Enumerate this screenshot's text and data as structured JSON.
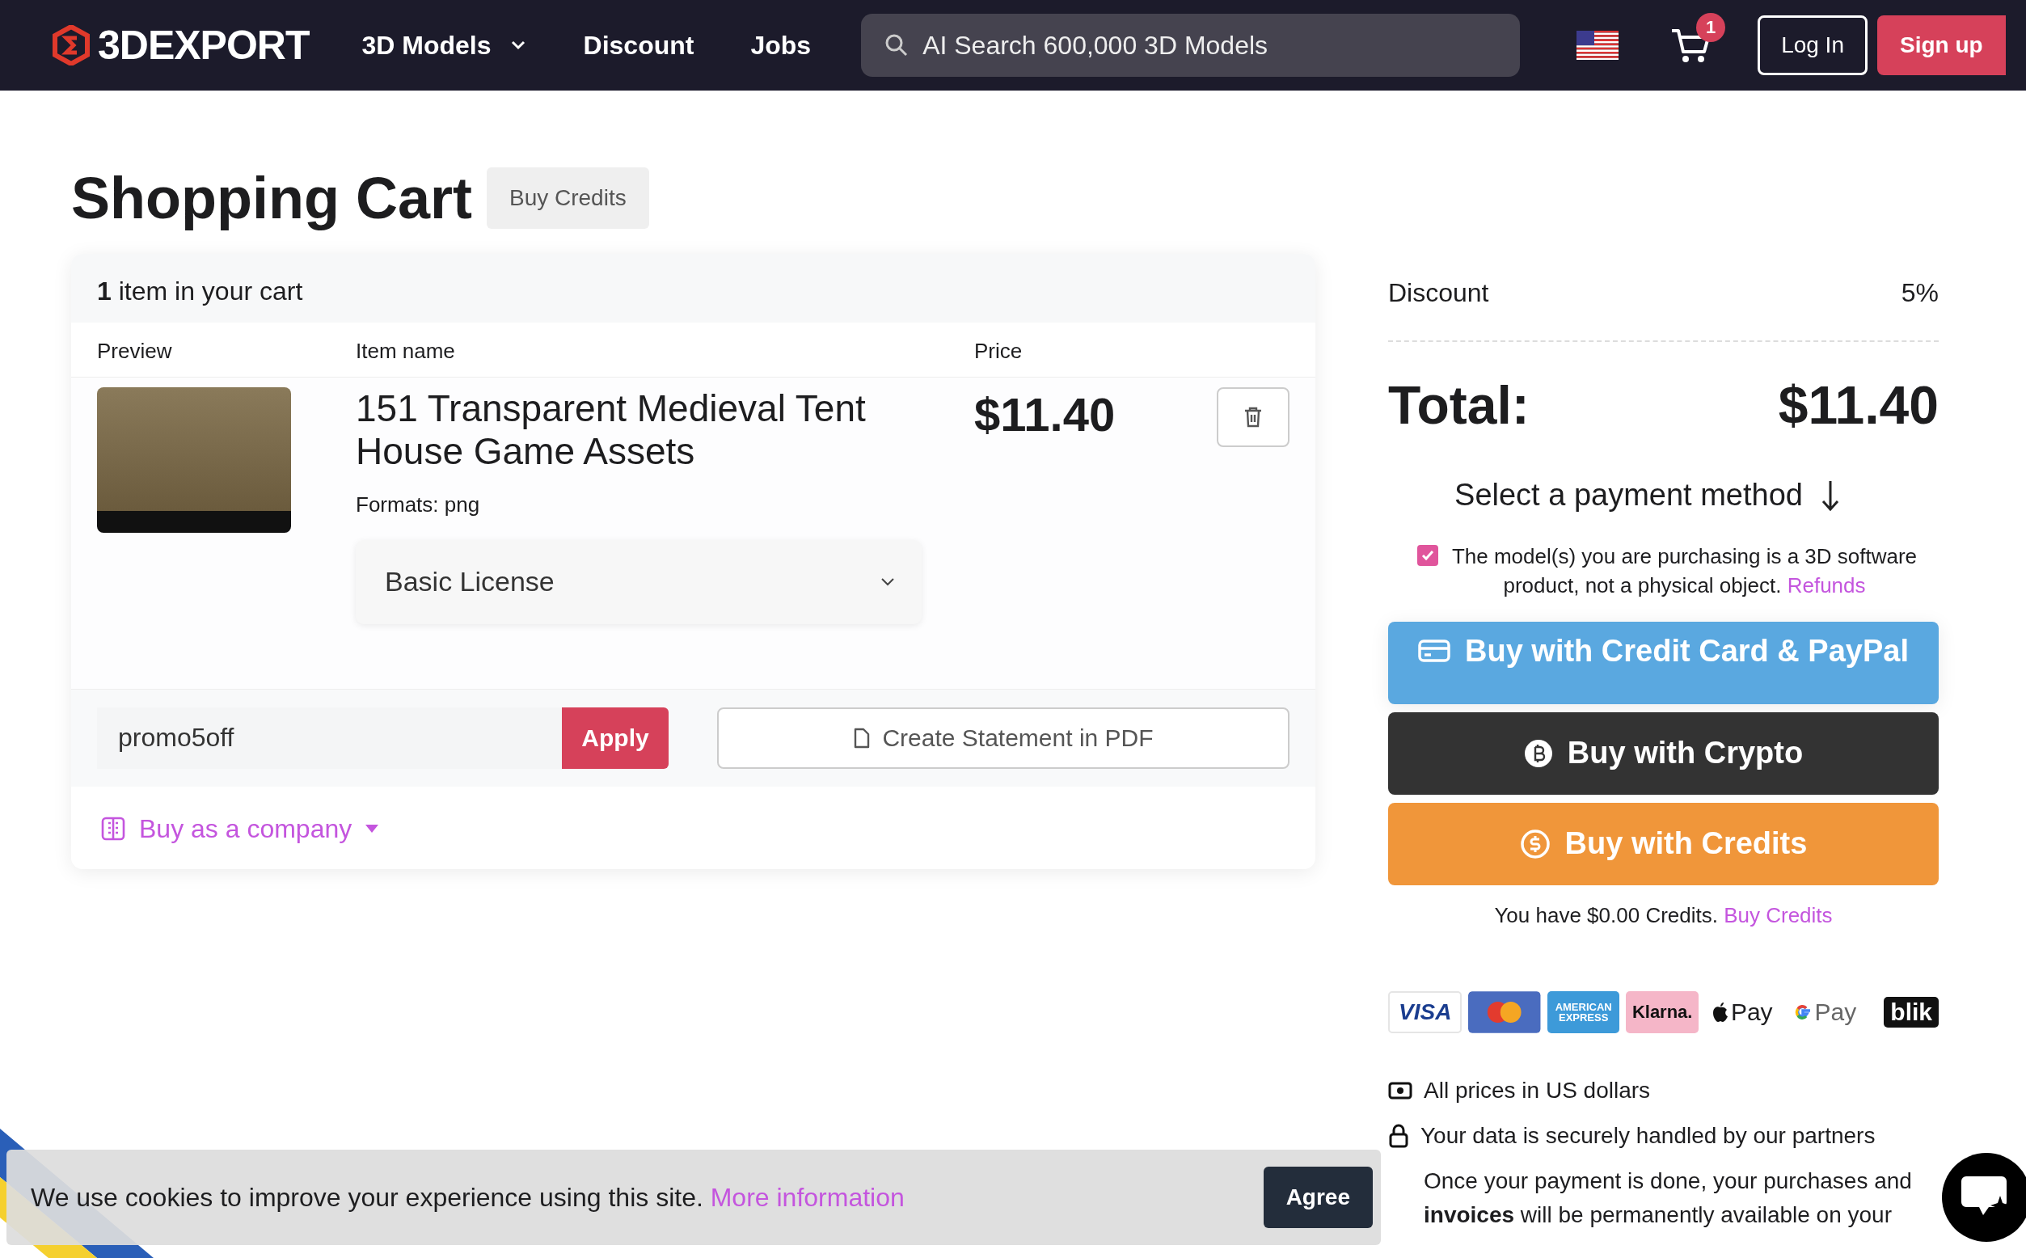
{
  "header": {
    "logo": "3DEXPORT",
    "nav": [
      {
        "label": "3D Models",
        "dropdown": true
      },
      {
        "label": "Discount",
        "dropdown": false
      },
      {
        "label": "Jobs",
        "dropdown": false
      }
    ],
    "search": {
      "placeholder": "AI Search 600,000 3D Models"
    },
    "cart_count": "1",
    "login": "Log In",
    "signup": "Sign up"
  },
  "page": {
    "title": "Shopping Cart",
    "buy_credits": "Buy Credits"
  },
  "cart": {
    "summary": "**1** item in your cart",
    "columns": [
      "Preview",
      "Item name",
      "Price"
    ],
    "items": [
      {
        "name": "151 Transparent Medieval Tent House Game Assets",
        "formats": "Formats: png",
        "price": "$11.40",
        "license": "Basic License"
      }
    ],
    "promo": {
      "value": "promo5off",
      "apply": "Apply"
    },
    "statement": "Create Statement in PDF",
    "company": "Buy as a company"
  },
  "summary": {
    "discount_label": "Discount",
    "discount_value": "5%",
    "total_label": "Total:",
    "total_value": "$11.40",
    "select_method": "Select a payment method",
    "terms": {
      "checked": true,
      "text": "The model(s) you are purchasing is a 3D software product, not a physical object.",
      "link": "Refunds"
    },
    "buttons": [
      {
        "kind": "card",
        "label": "Buy with Credit Card & PayPal"
      },
      {
        "kind": "crypto",
        "label": "Buy with Crypto"
      },
      {
        "kind": "credits",
        "label": "Buy with Credits"
      }
    ],
    "credits_text": "You have $0.00 Credits.",
    "credits_link": "Buy Credits",
    "payment_methods": [
      {
        "kind": "visa",
        "label": "VISA"
      },
      {
        "kind": "mastercard"
      },
      {
        "kind": "amex",
        "label": "AMERICAN EXPRESS"
      },
      {
        "kind": "klarna",
        "label": "Klarna."
      },
      {
        "kind": "applepay",
        "label": "Pay"
      },
      {
        "kind": "gpay",
        "label": "Pay"
      },
      {
        "kind": "blik",
        "label": "blik"
      }
    ],
    "info": [
      {
        "kind": "money",
        "text": "All prices in US dollars"
      },
      {
        "kind": "lock",
        "text": "Your data is securely handled by our partners"
      },
      {
        "kind": "none",
        "text": "Once your payment is done, your purchases and **invoices** will be permanently available on your"
      }
    ]
  },
  "cookie": {
    "text": "We use cookies to improve your experience using this site.",
    "link": "More information",
    "agree": "Agree"
  }
}
